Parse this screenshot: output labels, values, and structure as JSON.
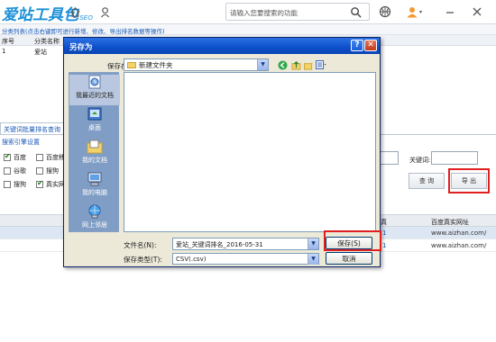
{
  "app": {
    "logo_text": "爱站工具包",
    "logo_sub": "SEO",
    "search_placeholder": "请输入您要搜索的功能",
    "nav_strip": "分类列表(点击右键即可进行新增、修改、导出排名数据等操作)",
    "grid_headers": [
      "序号",
      "分类名称"
    ],
    "grid_row": [
      "1",
      "爱站"
    ]
  },
  "bottom": {
    "tab_label": "关键词批量排名查询",
    "settings_title": "搜索引擎设置",
    "checkboxes": [
      {
        "label": "百度",
        "checked": true
      },
      {
        "label": "百度移",
        "checked": false
      },
      {
        "label": "谷歌",
        "checked": false
      },
      {
        "label": "搜狗",
        "checked": false
      },
      {
        "label": "搜狗",
        "checked": false
      },
      {
        "label": "真实网",
        "checked": true
      }
    ],
    "keyword_label": "关键词:",
    "query_button": "查 询",
    "export_button": "导 出",
    "result_headers": [
      "真",
      "百度真实网址"
    ],
    "result_rows": [
      {
        "col1": "1",
        "url": "www.aizhan.com/"
      },
      {
        "col1": "1",
        "url": "www.aizhan.com/"
      }
    ]
  },
  "dialog": {
    "title": "另存为",
    "help_glyph": "?",
    "close_glyph": "✕",
    "save_in_label": "保存在(I):",
    "save_in_value": "新建文件夹",
    "places": [
      {
        "label": "我最近的文档",
        "icon": "recent-documents-icon"
      },
      {
        "label": "桌面",
        "icon": "desktop-icon"
      },
      {
        "label": "我的文档",
        "icon": "my-documents-icon"
      },
      {
        "label": "我的电脑",
        "icon": "my-computer-icon"
      },
      {
        "label": "网上邻居",
        "icon": "network-places-icon"
      }
    ],
    "filename_label": "文件名(N):",
    "filename_value": "爱站_关键词排名_2016-05-31",
    "filetype_label": "保存类型(T):",
    "filetype_value": "CSV(.csv)",
    "save_button": "保存(S)",
    "cancel_button": "取消"
  },
  "colors": {
    "brand": "#1a8fd8",
    "highlight": "#e02020",
    "titlebar": "#0d4fc8"
  }
}
